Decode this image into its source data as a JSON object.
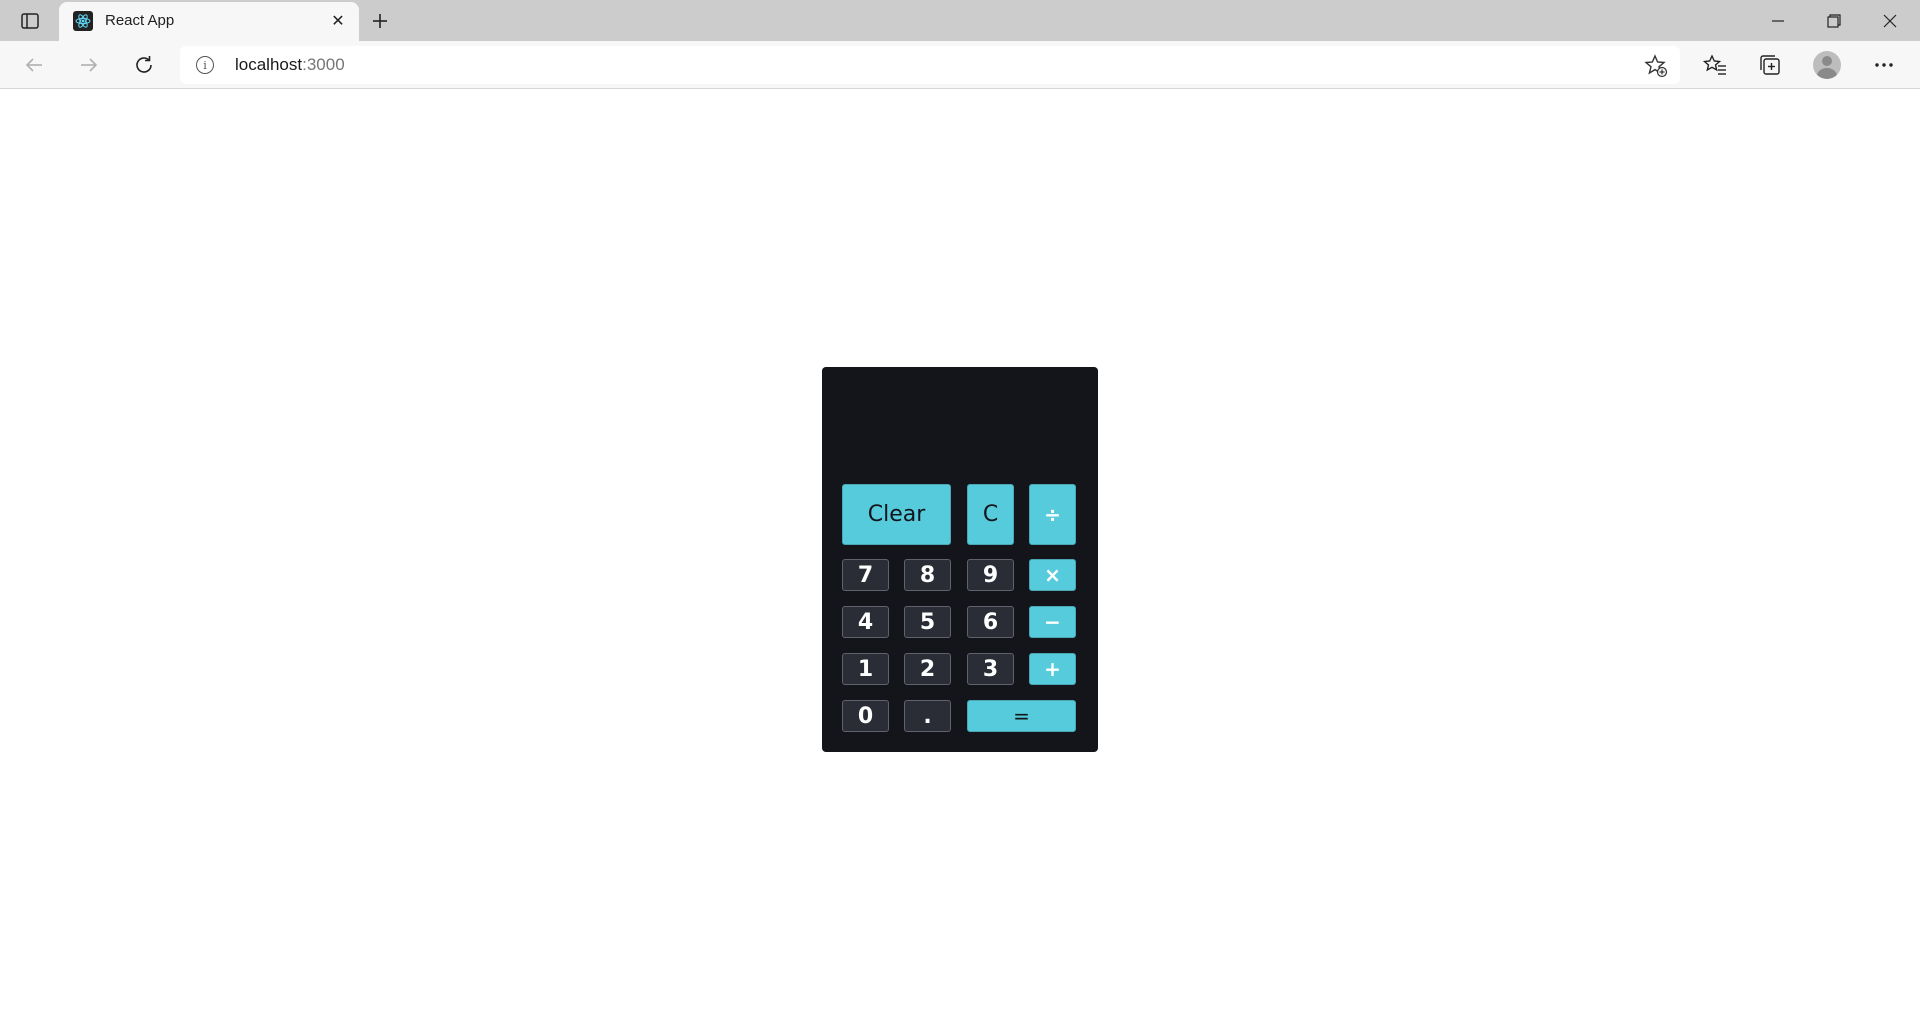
{
  "browser": {
    "tab_title": "React App",
    "tab_close": "✕",
    "url_host": "localhost",
    "url_port": ":3000"
  },
  "calculator": {
    "display": "",
    "buttons": {
      "clear": "Clear",
      "c": "C",
      "divide": "÷",
      "seven": "7",
      "eight": "8",
      "nine": "9",
      "multiply": "×",
      "four": "4",
      "five": "5",
      "six": "6",
      "subtract": "−",
      "one": "1",
      "two": "2",
      "three": "3",
      "add": "+",
      "zero": "0",
      "decimal": ".",
      "equals": "="
    }
  },
  "colors": {
    "calculator_bg": "#13151b",
    "number_key": "#2a2c36",
    "accent_key": "#56cbdb"
  }
}
